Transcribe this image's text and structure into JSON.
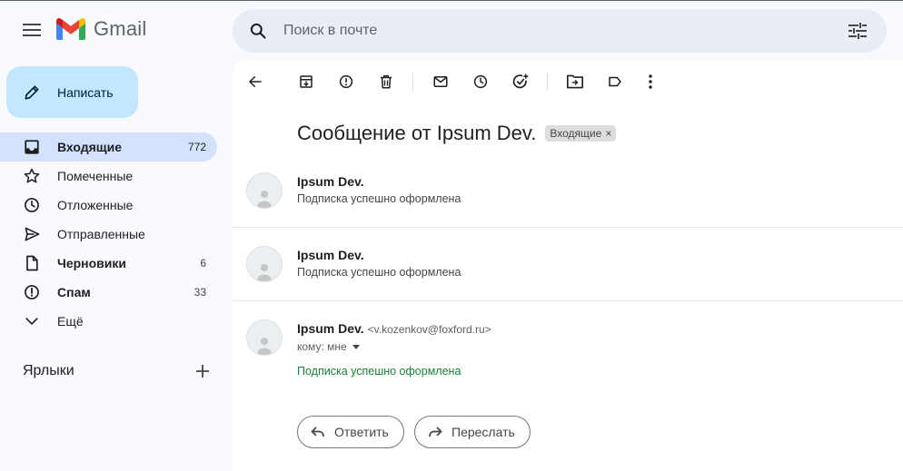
{
  "app": {
    "name": "Gmail"
  },
  "search": {
    "placeholder": "Поиск в почте"
  },
  "compose": {
    "label": "Написать"
  },
  "nav": [
    {
      "label": "Входящие",
      "count": "772",
      "icon": "inbox-icon"
    },
    {
      "label": "Помеченные",
      "count": "",
      "icon": "star-icon"
    },
    {
      "label": "Отложенные",
      "count": "",
      "icon": "clock-icon"
    },
    {
      "label": "Отправленные",
      "count": "",
      "icon": "send-icon"
    },
    {
      "label": "Черновики",
      "count": "6",
      "icon": "draft-icon"
    },
    {
      "label": "Спам",
      "count": "33",
      "icon": "spam-icon"
    },
    {
      "label": "Ещё",
      "count": "",
      "icon": "chevron-down-icon"
    }
  ],
  "labels": {
    "title": "Ярлыки"
  },
  "thread": {
    "subject": "Сообщение от Ipsum Dev.",
    "chip": "Входящие",
    "chip_close": "×",
    "messages": [
      {
        "sender": "Ipsum Dev.",
        "snippet": "Подписка успешно оформлена"
      },
      {
        "sender": "Ipsum Dev.",
        "snippet": "Подписка успешно оформлена"
      },
      {
        "sender": "Ipsum Dev.",
        "email": "<v.kozenkov@foxford.ru>",
        "to": "кому: мне",
        "body": "Подписка успешно оформлена"
      }
    ],
    "reply_label": "Ответить",
    "forward_label": "Переслать"
  },
  "colors": {
    "accent": "#c2e7ff",
    "active_nav": "#d3e3fd",
    "body_link": "#188038"
  }
}
